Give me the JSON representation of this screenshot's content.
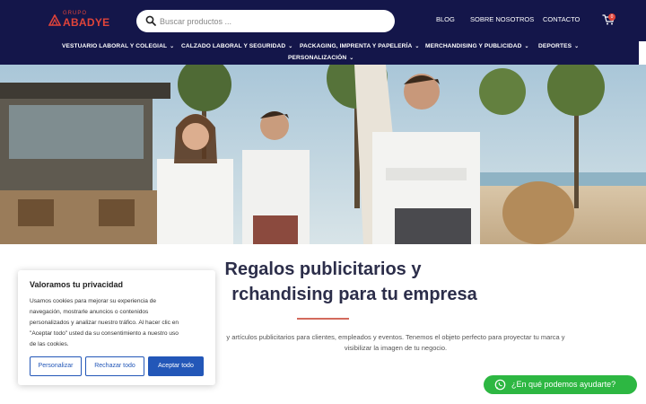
{
  "brand": {
    "logo_small": "GRUPO",
    "logo_big": "ABADYE"
  },
  "search": {
    "placeholder": "Buscar productos ..."
  },
  "top_links": [
    "BLOG",
    "SOBRE NOSOTROS",
    "CONTACTO"
  ],
  "cart": {
    "count": "0"
  },
  "nav": [
    "VESTUARIO LABORAL Y COLEGIAL",
    "CALZADO LABORAL Y SEGURIDAD",
    "PACKAGING, IMPRENTA Y PAPELERÍA",
    "MERCHANDISING Y PUBLICIDAD",
    "DEPORTES",
    "PERSONALIZACIÓN"
  ],
  "hero": {
    "alt": ""
  },
  "content": {
    "headline_line1": "Regalos publicitarios y",
    "headline_line2": "rchandising para tu empresa",
    "paragraph_line1": "y artículos publicitarios para clientes, empleados y eventos. Tenemos el objeto perfecto para proyectar tu marca y",
    "paragraph_line2": "visibilizar la imagen de tu negocio."
  },
  "cookie": {
    "title": "Valoramos tu privacidad",
    "text_lines": [
      "Usamos cookies para mejorar su experiencia de",
      "navegación, mostrarle anuncios o contenidos",
      "personalizados y analizar nuestro tráfico. Al hacer clic en",
      "\"Aceptar todo\" usted da su consentimiento a nuestro uso",
      "de las cookies."
    ],
    "btn_customize": "Personalizar",
    "btn_reject": "Rechazar todo",
    "btn_accept": "Aceptar todo"
  },
  "whatsapp": {
    "label": "¿En qué podemos ayudarte?"
  },
  "colors": {
    "header_bg": "#14164a",
    "brand_red": "#e0443a",
    "accent_blue": "#2357b8",
    "whatsapp_green": "#2db742"
  },
  "icons": {
    "search": "magnifier-icon",
    "cart": "cart-icon",
    "whatsapp": "whatsapp-icon",
    "chevron": "chevron-down-icon"
  }
}
